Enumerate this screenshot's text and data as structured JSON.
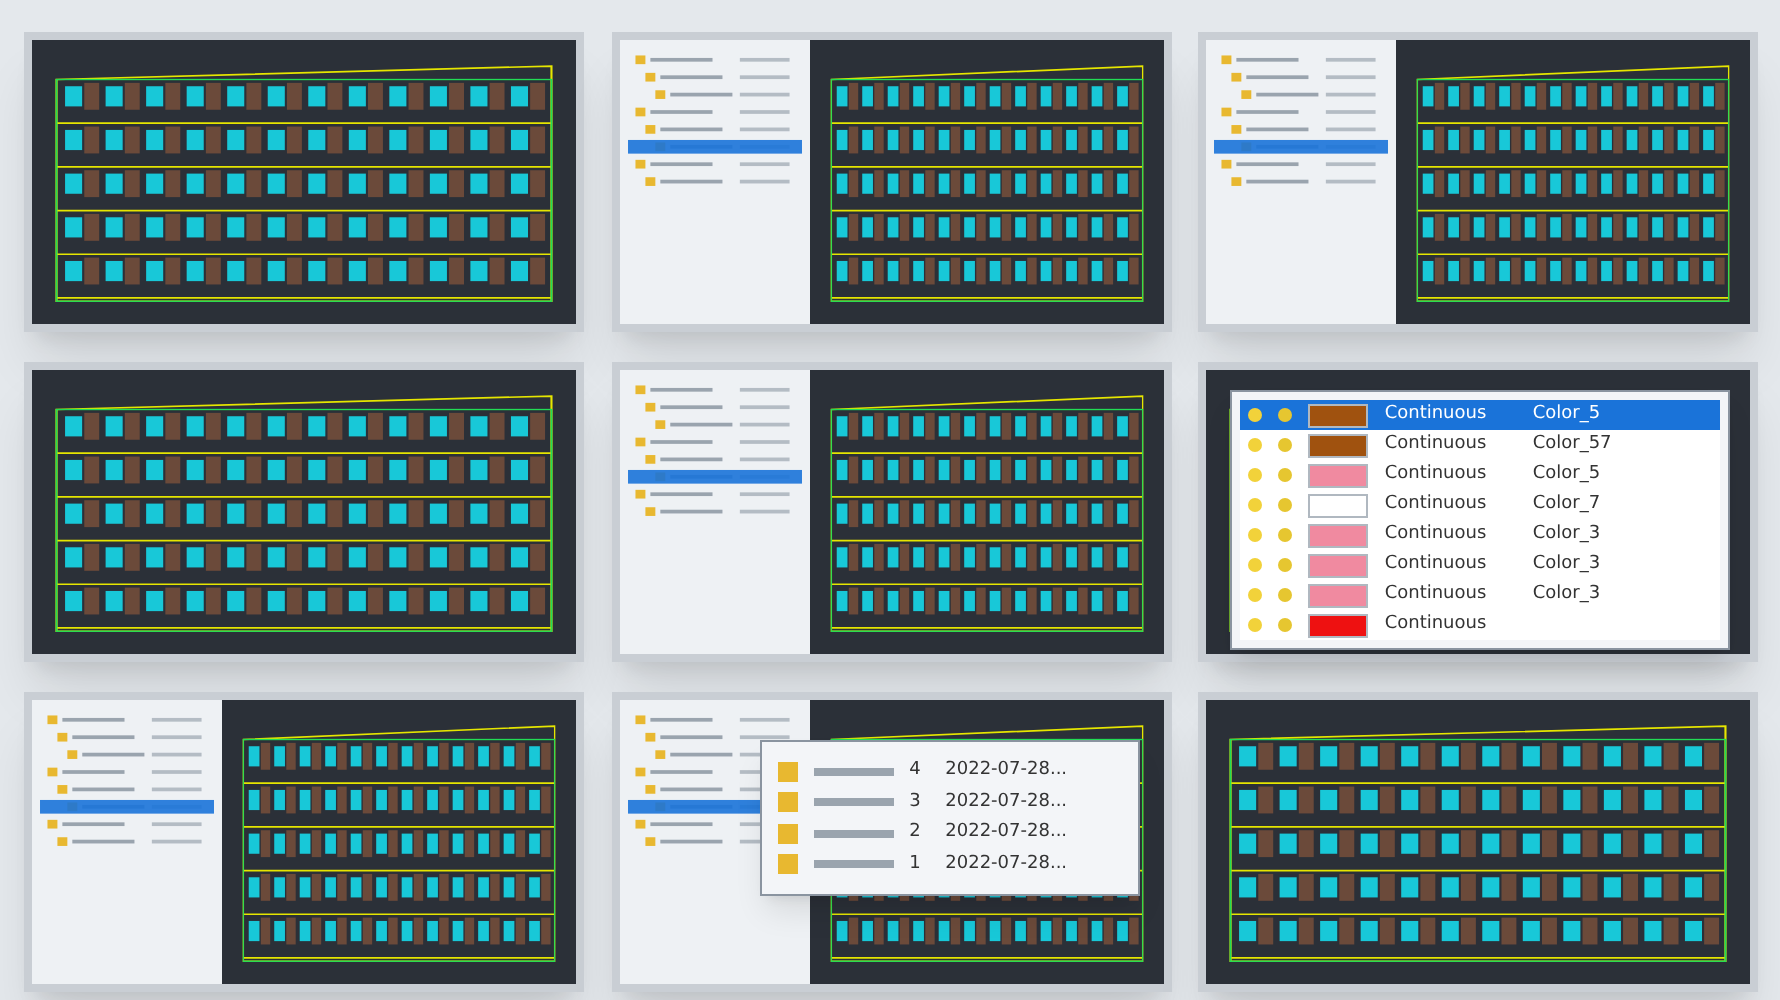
{
  "tiles": [
    {
      "kind": "plain"
    },
    {
      "kind": "files"
    },
    {
      "kind": "files"
    },
    {
      "kind": "plain"
    },
    {
      "kind": "files"
    },
    {
      "kind": "layers"
    },
    {
      "kind": "files"
    },
    {
      "kind": "versions"
    },
    {
      "kind": "plain"
    }
  ],
  "layer_table": {
    "rows": [
      {
        "color": "#a0520f",
        "linetype": "Continuous",
        "color_name": "Color_5",
        "selected": true
      },
      {
        "color": "#a0520f",
        "linetype": "Continuous",
        "color_name": "Color_57",
        "selected": false
      },
      {
        "color": "#f08aa0",
        "linetype": "Continuous",
        "color_name": "Color_5",
        "selected": false
      },
      {
        "color": "#ffffff",
        "linetype": "Continuous",
        "color_name": "Color_7",
        "selected": false
      },
      {
        "color": "#f08aa0",
        "linetype": "Continuous",
        "color_name": "Color_3",
        "selected": false
      },
      {
        "color": "#f08aa0",
        "linetype": "Continuous",
        "color_name": "Color_3",
        "selected": false
      },
      {
        "color": "#f08aa0",
        "linetype": "Continuous",
        "color_name": "Color_3",
        "selected": false
      },
      {
        "color": "#ee1111",
        "linetype": "Continuous",
        "selected": false
      }
    ]
  },
  "version_list": {
    "rows": [
      {
        "version": "4",
        "date": "2022-07-28..."
      },
      {
        "version": "3",
        "date": "2022-07-28..."
      },
      {
        "version": "2",
        "date": "2022-07-28..."
      },
      {
        "version": "1",
        "date": "2022-07-28..."
      }
    ]
  }
}
